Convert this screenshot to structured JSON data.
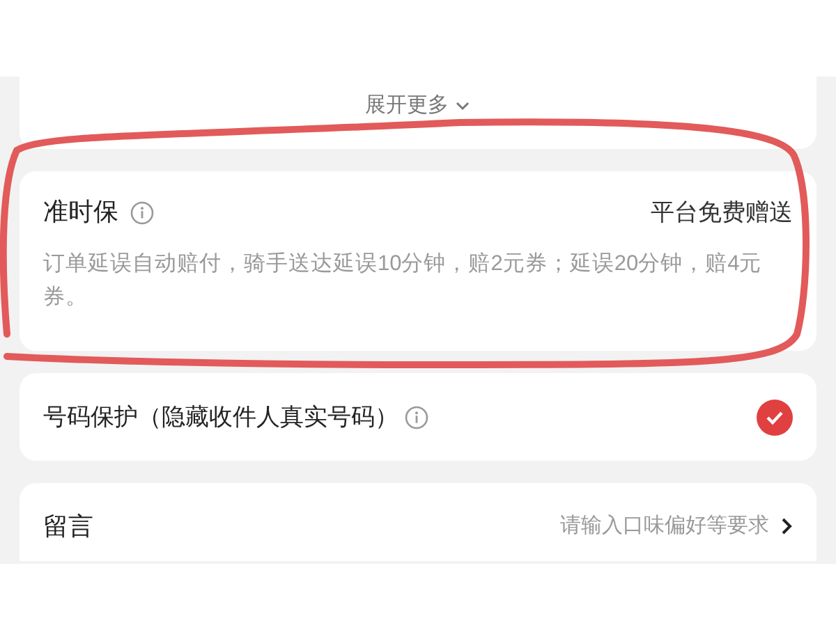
{
  "expand": {
    "label": "展开更多"
  },
  "ontime": {
    "title": "准时保",
    "badge": "平台免费赠送",
    "description": "订单延误自动赔付，骑手送达延误10分钟，赔2元券；延误20分钟，赔4元券。"
  },
  "number_protection": {
    "label": "号码保护（隐藏收件人真实号码）",
    "checked": true
  },
  "message": {
    "label": "留言",
    "hint": "请输入口味偏好等要求"
  }
}
